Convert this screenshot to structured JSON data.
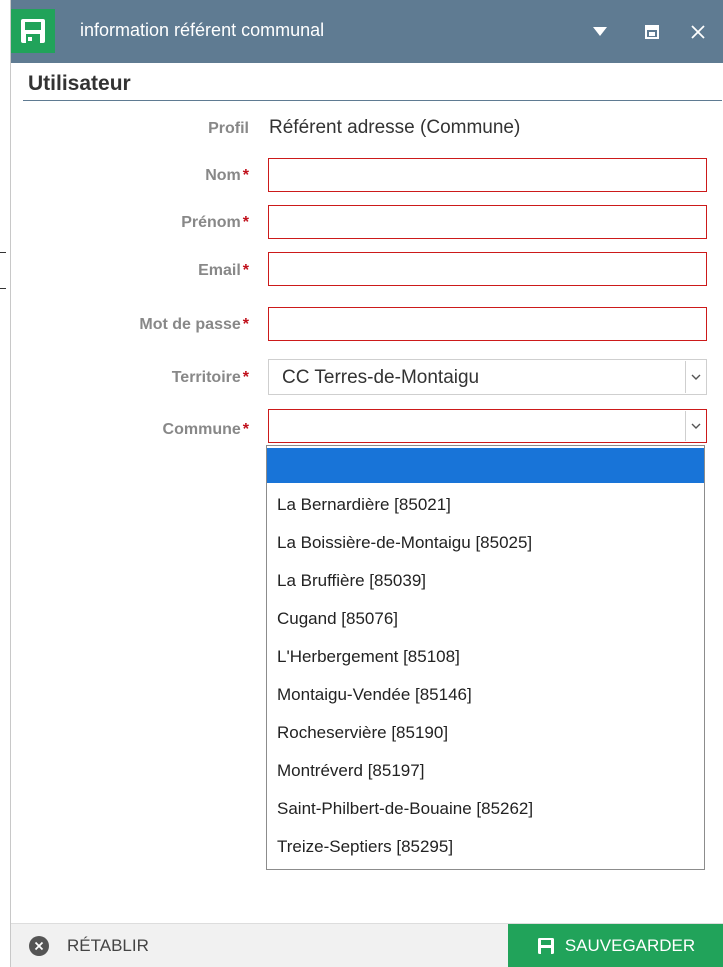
{
  "window": {
    "title": "information référent communal"
  },
  "section": {
    "title": "Utilisateur"
  },
  "form": {
    "profil": {
      "label": "Profil",
      "value": "Référent adresse (Commune)"
    },
    "nom": {
      "label": "Nom",
      "required_mark": "*",
      "value": ""
    },
    "prenom": {
      "label": "Prénom",
      "required_mark": "*",
      "value": ""
    },
    "email": {
      "label": "Email",
      "required_mark": "*",
      "value": ""
    },
    "password": {
      "label": "Mot de passe",
      "required_mark": "*",
      "value": ""
    },
    "territoire": {
      "label": "Territoire",
      "required_mark": "*",
      "selected": "CC Terres-de-Montaigu"
    },
    "commune": {
      "label": "Commune",
      "required_mark": "*",
      "selected": ""
    }
  },
  "commune_options": [
    "",
    "La Bernardière [85021]",
    "La Boissière-de-Montaigu [85025]",
    "La Bruffière [85039]",
    "Cugand [85076]",
    "L'Herbergement [85108]",
    "Montaigu-Vendée [85146]",
    "Rocheservière [85190]",
    "Montréverd [85197]",
    "Saint-Philbert-de-Bouaine [85262]",
    "Treize-Septiers [85295]"
  ],
  "footer": {
    "reset_label": "RÉTABLIR",
    "save_label": "SAUVEGARDER"
  },
  "colors": {
    "titlebar": "#5f7b92",
    "accent_green": "#21a35a",
    "error_border": "#cc1a1a",
    "selection_blue": "#1874d8"
  },
  "icons": {
    "app": "save-icon",
    "menu": "caret-down-icon",
    "maximize": "maximize-icon",
    "close": "close-icon",
    "reset": "close-circle-icon",
    "save": "save-icon"
  }
}
